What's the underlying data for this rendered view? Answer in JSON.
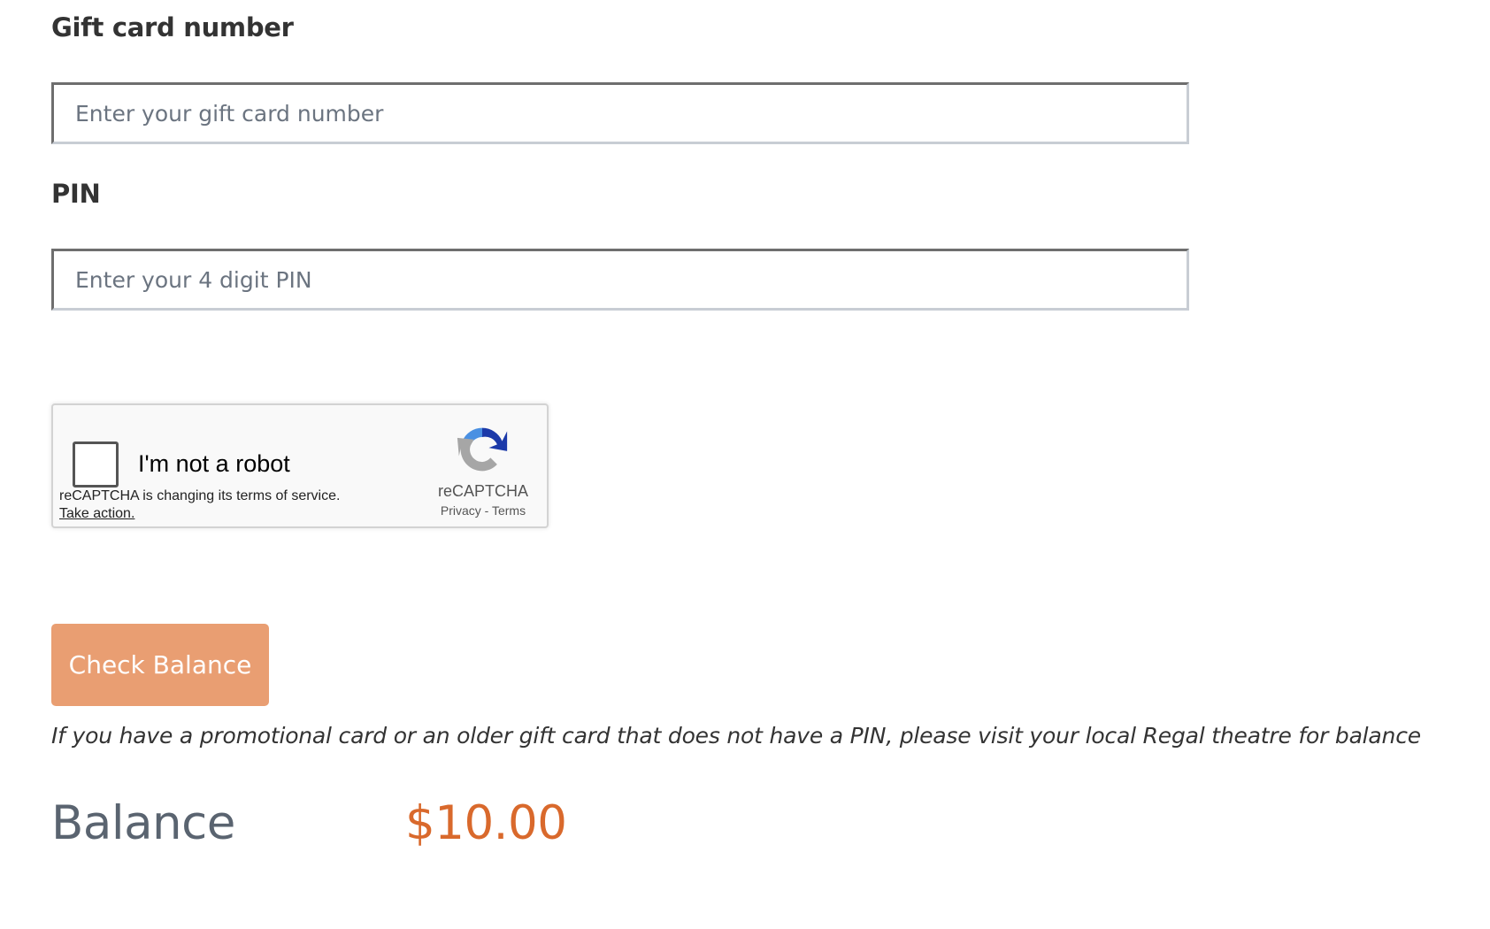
{
  "form": {
    "gift_card_label": "Gift card number",
    "gift_card_placeholder": "Enter your gift card number",
    "gift_card_value": "",
    "pin_label": "PIN",
    "pin_placeholder": "Enter your 4 digit PIN",
    "pin_value": ""
  },
  "captcha": {
    "checkbox_label": "I'm not a robot",
    "checked": false,
    "notice": "reCAPTCHA is changing its terms of service.",
    "notice_link": "Take action.",
    "brand": "reCAPTCHA",
    "privacy_link": "Privacy",
    "separator": " - ",
    "terms_link": "Terms",
    "icon": "recaptcha-logo-icon"
  },
  "actions": {
    "check_balance_label": "Check Balance"
  },
  "note": "If you have a promotional card or an older gift card that does not have a PIN, please visit your local Regal theatre for balance",
  "balance": {
    "label": "Balance",
    "value": "$10.00"
  },
  "colors": {
    "button_bg": "#e99e72",
    "balance_value": "#d9692c",
    "label_text": "#333333",
    "balance_label": "#5a6470"
  }
}
